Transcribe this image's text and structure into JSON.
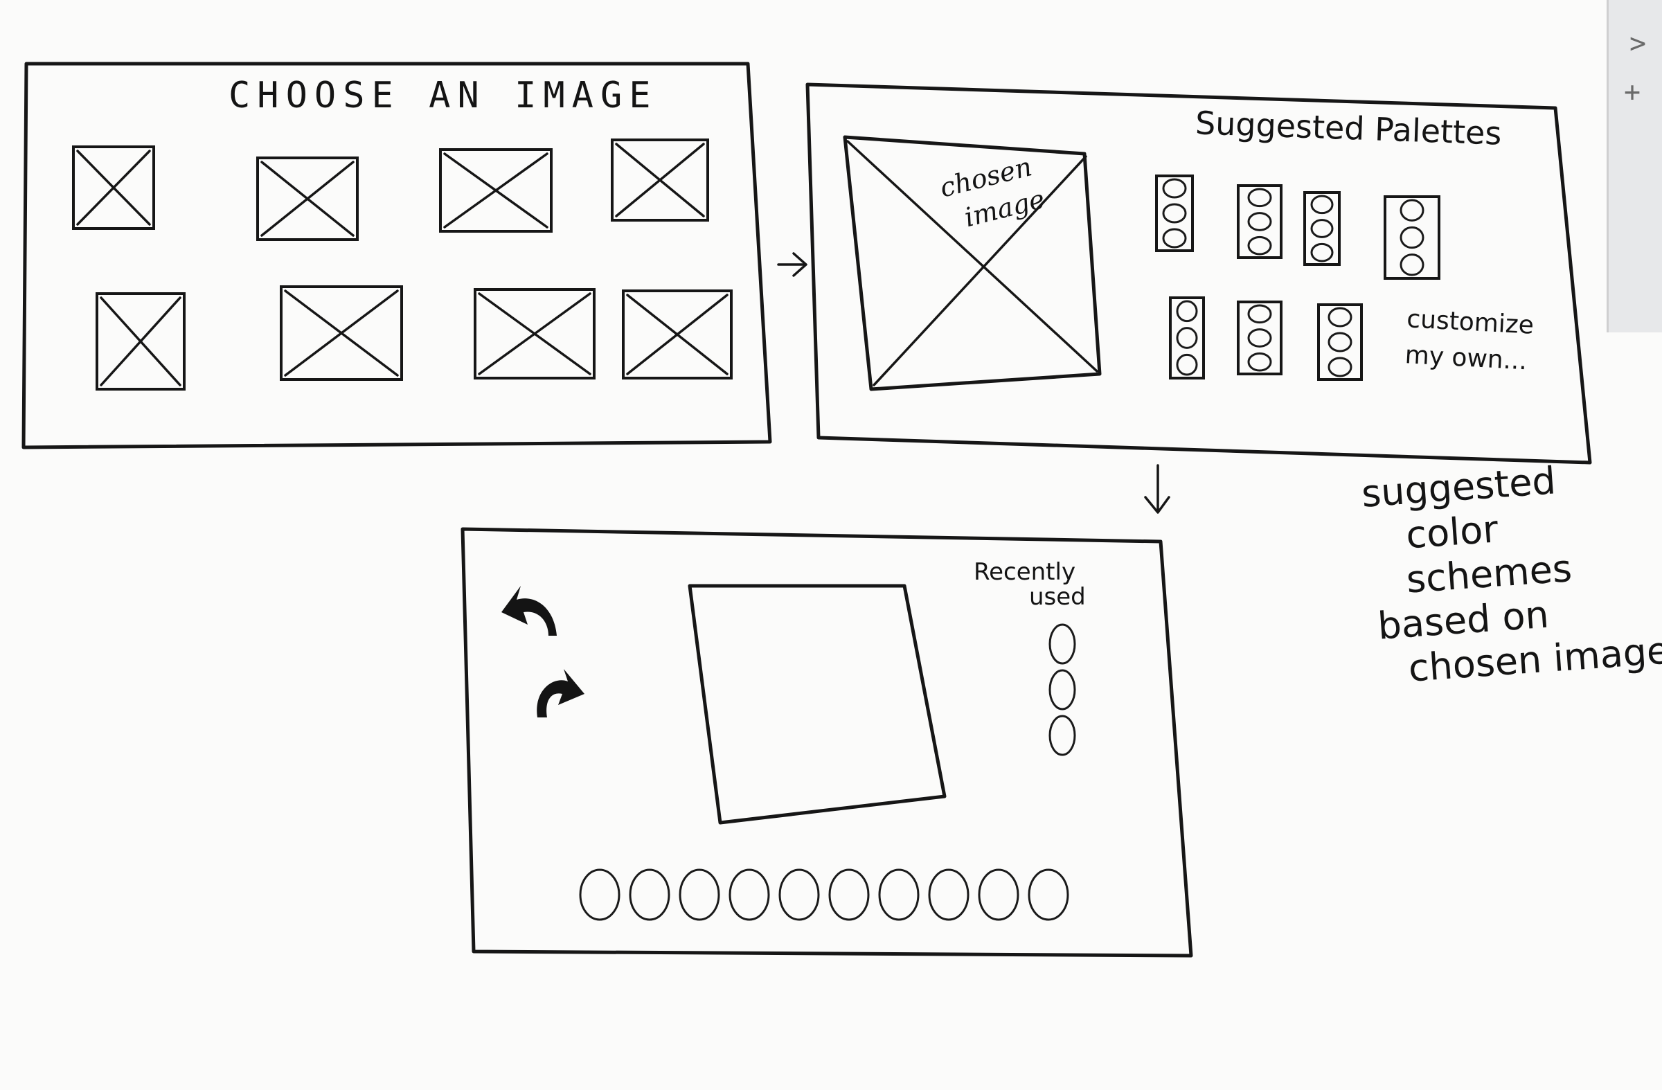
{
  "screen1": {
    "title": "CHOOSE AN IMAGE",
    "thumbnails": 8
  },
  "screen2": {
    "chosen_image_lines": [
      "chosen",
      "image"
    ],
    "palettes_title": "Suggested Palettes",
    "palettes": [
      {
        "swatches": 3
      },
      {
        "swatches": 3
      },
      {
        "swatches": 3
      },
      {
        "swatches": 3
      },
      {
        "swatches": 3
      },
      {
        "swatches": 3
      },
      {
        "swatches": 3
      }
    ],
    "customize_lines": [
      "customize",
      "my own..."
    ]
  },
  "screen3": {
    "recent_lines": [
      "Recently",
      "used"
    ],
    "recent_swatches": 3,
    "bottom_swatches": 10,
    "undo_icon": "undo-arrow-icon",
    "redo_icon": "redo-arrow-icon"
  },
  "note_lines": [
    "suggested",
    "color",
    "schemes",
    "based on",
    "chosen image"
  ]
}
